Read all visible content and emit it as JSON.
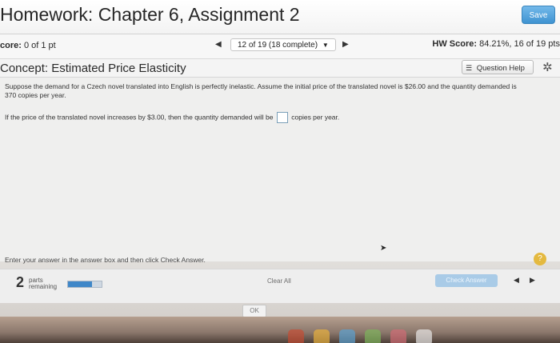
{
  "header": {
    "title": "Homework: Chapter 6, Assignment 2",
    "save_label": "Save"
  },
  "score_row": {
    "score_label": "core:",
    "score_value": "0 of 1 pt",
    "progress_text": "12 of 19 (18 complete)",
    "hw_score_label": "HW Score:",
    "hw_score_value": "84.21%, 16 of 19 pts"
  },
  "concept_row": {
    "concept": "Concept: Estimated Price Elasticity",
    "help_label": "Question Help"
  },
  "problem": {
    "line1": "Suppose the demand for a Czech novel translated into English is perfectly inelastic. Assume the initial price of the translated novel is $26.00 and the quantity demanded is 370 copies per year.",
    "question_before": "If the price of the translated novel increases by $3.00, then the quantity demanded will be",
    "question_after": "copies per year."
  },
  "footer": {
    "instruction": "Enter your answer in the answer box and then click Check Answer.",
    "parts_number": "2",
    "parts_label_1": "parts",
    "parts_label_2": "remaining",
    "clear_all": "Clear All",
    "check_answer": "Check Answer",
    "ok": "OK",
    "help_mark": "?"
  },
  "colors": {
    "accent": "#3f93d1",
    "help_gold": "#e4b93f",
    "check_answer_disabled": "#a9cbe7"
  }
}
